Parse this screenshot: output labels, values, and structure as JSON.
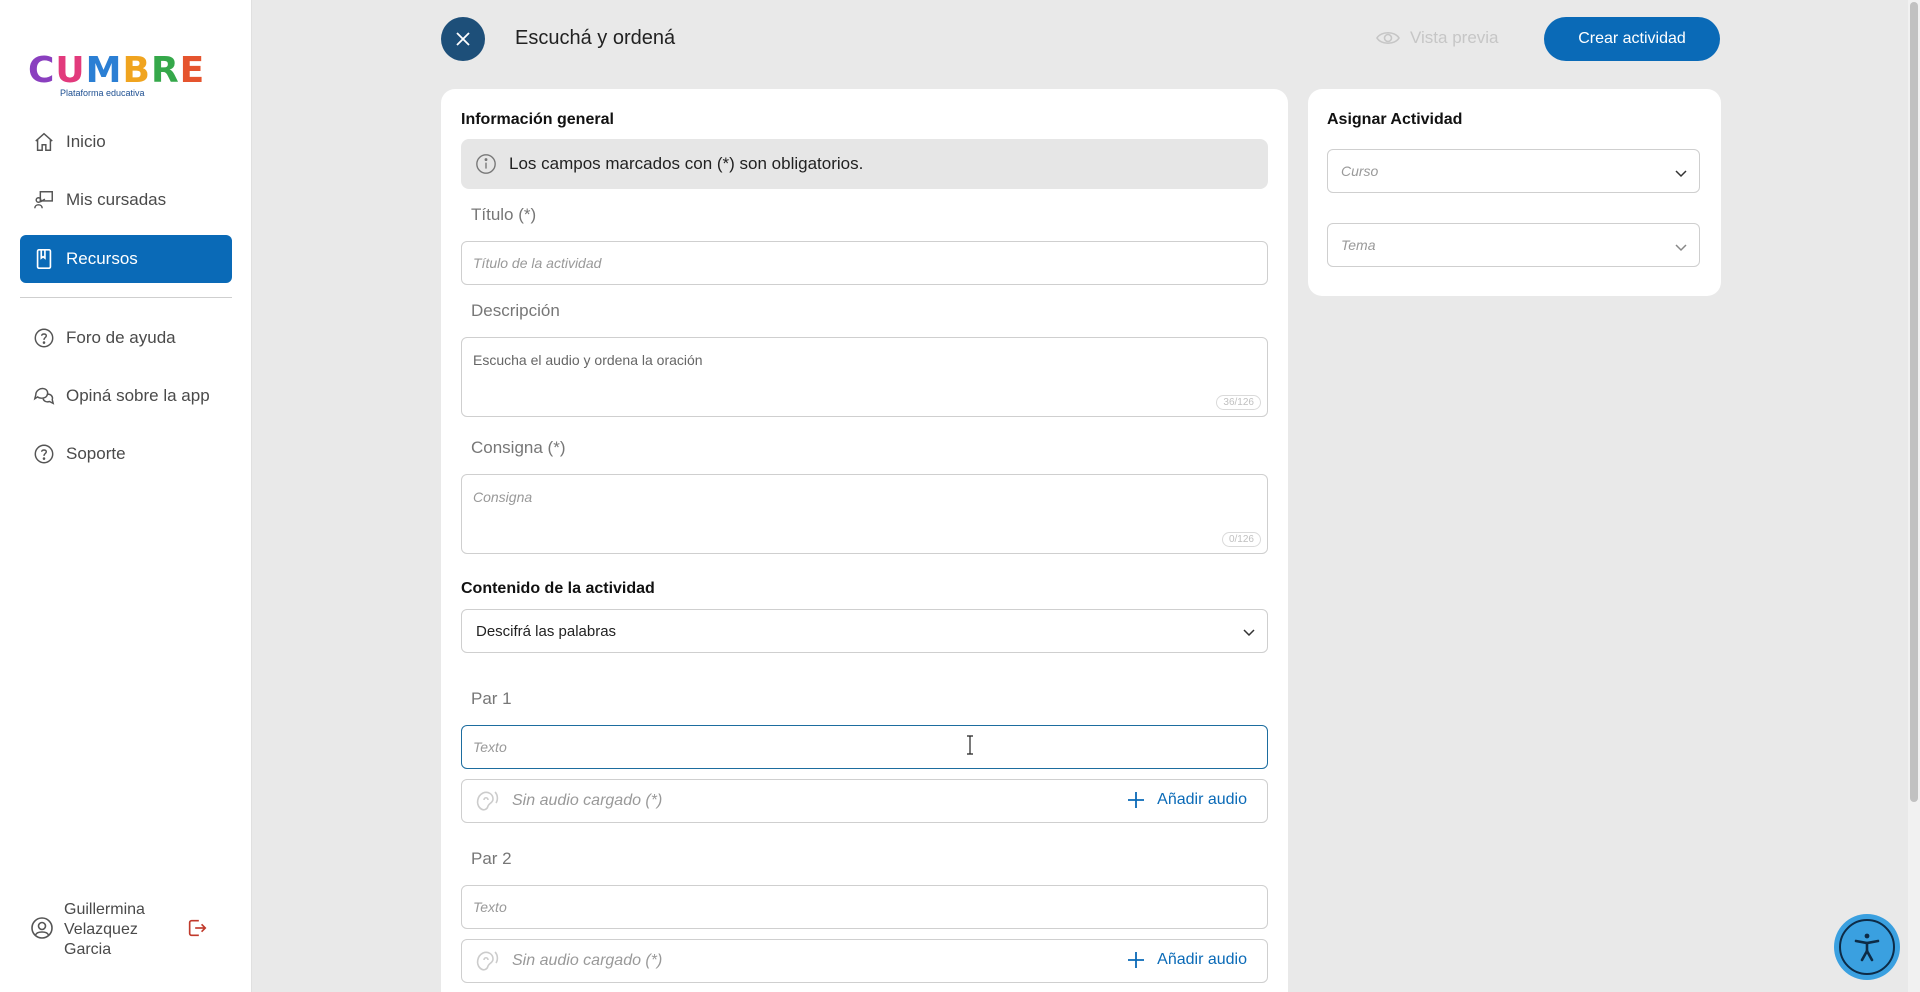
{
  "brand": {
    "letters": [
      {
        "ch": "C",
        "color": "#8a3fbf"
      },
      {
        "ch": "U",
        "color": "#e23a7c"
      },
      {
        "ch": "M",
        "color": "#2b7fd4"
      },
      {
        "ch": "B",
        "color": "#f0a41f"
      },
      {
        "ch": "R",
        "color": "#35a84a"
      },
      {
        "ch": "E",
        "color": "#e5542e"
      }
    ],
    "subtitle": "Plataforma educativa"
  },
  "sidebar": {
    "items": [
      {
        "label": "Inicio",
        "icon": "home-icon"
      },
      {
        "label": "Mis cursadas",
        "icon": "teacher-icon"
      },
      {
        "label": "Recursos",
        "icon": "book-icon"
      },
      {
        "label": "Foro de ayuda",
        "icon": "help-circle-icon"
      },
      {
        "label": "Opiná sobre la app",
        "icon": "chat-bubbles-icon"
      },
      {
        "label": "Soporte",
        "icon": "help-circle-icon"
      }
    ],
    "active_index": 2,
    "user": {
      "name": "Guillermina Velazquez Garcia"
    }
  },
  "header": {
    "title": "Escuchá y ordená",
    "preview_label": "Vista previa",
    "create_label": "Crear actividad"
  },
  "form": {
    "general_title": "Información general",
    "notice": "Los campos marcados con (*) son obligatorios.",
    "title_label": "Título (*)",
    "title_placeholder": "Título de la actividad",
    "description_label": "Descripción",
    "description_value": "Escucha el audio y ordena la oración",
    "description_counter": "36/126",
    "instruction_label": "Consigna (*)",
    "instruction_placeholder": "Consigna",
    "instruction_counter": "0/126",
    "content_title": "Contenido de la actividad",
    "content_type": "Descifrá las palabras",
    "pairs": [
      {
        "label": "Par 1",
        "text_placeholder": "Texto",
        "audio_status": "Sin audio cargado (*)",
        "add_audio": "Añadir audio"
      },
      {
        "label": "Par 2",
        "text_placeholder": "Texto",
        "audio_status": "Sin audio cargado (*)",
        "add_audio": "Añadir audio"
      }
    ]
  },
  "assign": {
    "title": "Asignar Actividad",
    "course_placeholder": "Curso",
    "topic_placeholder": "Tema"
  },
  "colors": {
    "accent": "#0a6ab7",
    "close_button": "#1d4f79",
    "background": "#e9e9e9"
  }
}
